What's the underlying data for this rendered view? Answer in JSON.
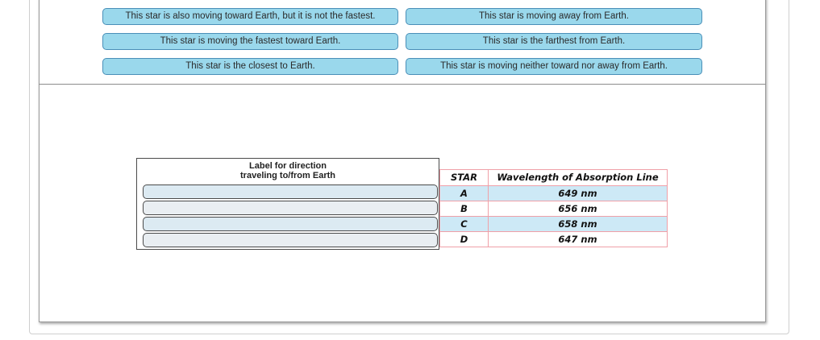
{
  "labels": {
    "l1": "This star is also moving toward Earth, but it is not the fastest.",
    "l2": "This star is moving away from Earth.",
    "l3": "This star is moving the fastest toward Earth.",
    "l4": "This star is the farthest from Earth.",
    "l5": "This star is the closest to Earth.",
    "l6": "This star is moving neither toward nor away from Earth."
  },
  "target": {
    "header_line1": "Label for direction",
    "header_line2": "traveling to/from Earth"
  },
  "table": {
    "col_star": "STAR",
    "col_wavelength": "Wavelength of Absorption Line",
    "rows": [
      {
        "star": "A",
        "wavelength": "649 nm"
      },
      {
        "star": "B",
        "wavelength": "656 nm"
      },
      {
        "star": "C",
        "wavelength": "658 nm"
      },
      {
        "star": "D",
        "wavelength": "647 nm"
      }
    ]
  },
  "colors": {
    "label_fill": "#9ad8ec",
    "label_border": "#4a8fb8",
    "table_border": "#f0a0a8",
    "row_shade": "#cde9f6"
  }
}
